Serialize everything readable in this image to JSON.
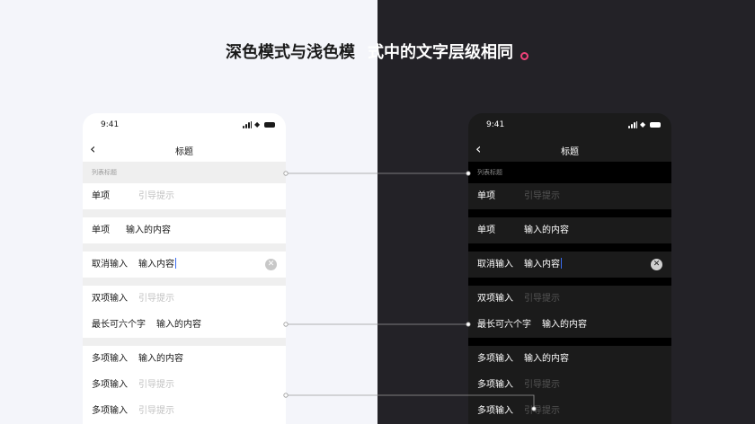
{
  "headline": {
    "left_part": "深色模式与浅色模",
    "right_part": "式中的文字层级相同"
  },
  "colors": {
    "light_bg": "#f4f5fa",
    "dark_bg": "#232227",
    "accent_dot": "#f0427a",
    "caret": "#3a6df0"
  },
  "phones": [
    {
      "theme": "light",
      "status_time": "9:41",
      "nav_title": "标题",
      "back_icon": "chevron-left-icon",
      "section_label": "列表标题",
      "rows": [
        {
          "label": "单项",
          "value": "引导提示",
          "placeholder": true
        },
        {
          "label": "单项",
          "value": "输入的内容",
          "placeholder": false
        },
        {
          "label": "取消输入",
          "value": "输入内容",
          "placeholder": false
        },
        {
          "label": "双项输入",
          "value": "引导提示",
          "placeholder": true
        },
        {
          "label": "最长可六个字",
          "value": "输入的内容",
          "placeholder": false
        },
        {
          "label": "多项输入",
          "value": "输入的内容",
          "placeholder": false
        },
        {
          "label": "多项输入",
          "value": "引导提示",
          "placeholder": true
        },
        {
          "label": "多项输入",
          "value": "引导提示",
          "placeholder": true
        }
      ]
    },
    {
      "theme": "dark",
      "status_time": "9:41",
      "nav_title": "标题",
      "back_icon": "chevron-left-icon",
      "section_label": "列表标题",
      "rows": [
        {
          "label": "单项",
          "value": "引导提示",
          "placeholder": true
        },
        {
          "label": "单项",
          "value": "输入的内容",
          "placeholder": false
        },
        {
          "label": "取消输入",
          "value": "输入内容",
          "placeholder": false
        },
        {
          "label": "双项输入",
          "value": "引导提示",
          "placeholder": true
        },
        {
          "label": "最长可六个字",
          "value": "输入的内容",
          "placeholder": false
        },
        {
          "label": "多项输入",
          "value": "输入的内容",
          "placeholder": false
        },
        {
          "label": "多项输入",
          "value": "引导提示",
          "placeholder": true
        },
        {
          "label": "多项输入",
          "value": "引导提示",
          "placeholder": true
        }
      ]
    }
  ]
}
